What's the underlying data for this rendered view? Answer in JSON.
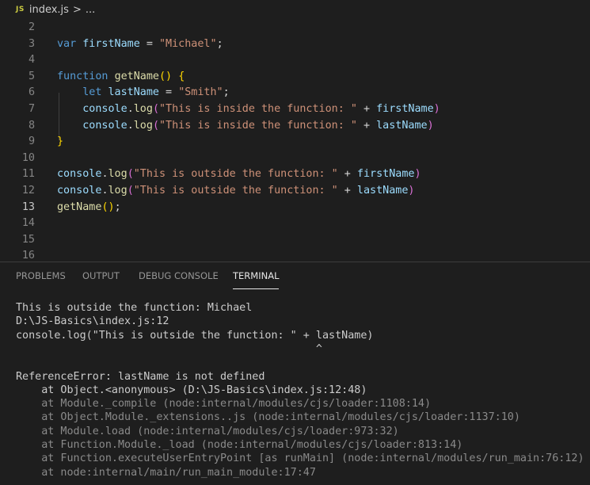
{
  "breadcrumb": {
    "badge": "JS",
    "file": "index.js",
    "chevron": ">",
    "ellipsis": "..."
  },
  "editor": {
    "active_line": "13",
    "lines": [
      {
        "n": "2"
      },
      {
        "n": "3",
        "t": [
          "var",
          " ",
          "firstName",
          " = ",
          "\"Michael\"",
          ";"
        ]
      },
      {
        "n": "4"
      },
      {
        "n": "5",
        "t": [
          "function",
          " ",
          "getName",
          "()",
          " ",
          "{"
        ]
      },
      {
        "n": "6",
        "t": [
          "let",
          " ",
          "lastName",
          " = ",
          "\"Smith\"",
          ";"
        ]
      },
      {
        "n": "7",
        "t": [
          "console",
          ".",
          "log",
          "(",
          "\"This is inside the function: \"",
          " + ",
          "firstName",
          ")"
        ]
      },
      {
        "n": "8",
        "t": [
          "console",
          ".",
          "log",
          "(",
          "\"This is inside the function: \"",
          " + ",
          "lastName",
          ")"
        ]
      },
      {
        "n": "9",
        "t": [
          "}"
        ]
      },
      {
        "n": "10"
      },
      {
        "n": "11",
        "t": [
          "console",
          ".",
          "log",
          "(",
          "\"This is outside the function: \"",
          " + ",
          "firstName",
          ")"
        ]
      },
      {
        "n": "12",
        "t": [
          "console",
          ".",
          "log",
          "(",
          "\"This is outside the function: \"",
          " + ",
          "lastName",
          ")"
        ]
      },
      {
        "n": "13",
        "t": [
          "getName",
          "();"
        ]
      },
      {
        "n": "14"
      },
      {
        "n": "15"
      },
      {
        "n": "16"
      }
    ]
  },
  "panel": {
    "tabs": [
      {
        "label": "PROBLEMS"
      },
      {
        "label": "OUTPUT"
      },
      {
        "label": "DEBUG CONSOLE"
      },
      {
        "label": "TERMINAL",
        "active": true
      }
    ],
    "terminal_lines": [
      "This is outside the function: Michael",
      "D:\\JS-Basics\\index.js:12",
      "console.log(\"This is outside the function: \" + lastName)",
      "                                               ^",
      "",
      "ReferenceError: lastName is not defined",
      "    at Object.<anonymous> (D:\\JS-Basics\\index.js:12:48)",
      "    at Module._compile (node:internal/modules/cjs/loader:1108:14)",
      "    at Object.Module._extensions..js (node:internal/modules/cjs/loader:1137:10)",
      "    at Module.load (node:internal/modules/cjs/loader:973:32)",
      "    at Function.Module._load (node:internal/modules/cjs/loader:813:14)",
      "    at Function.executeUserEntryPoint [as runMain] (node:internal/modules/run_main:76:12)",
      "    at node:internal/main/run_main_module:17:47"
    ]
  },
  "colors": {
    "background": "#1e1e1e",
    "keyword": "#569cd6",
    "variable": "#9cdcfe",
    "function": "#dcdcaa",
    "string": "#ce9178",
    "bracket_level1": "#ffd700",
    "bracket_level2": "#da70d6"
  }
}
